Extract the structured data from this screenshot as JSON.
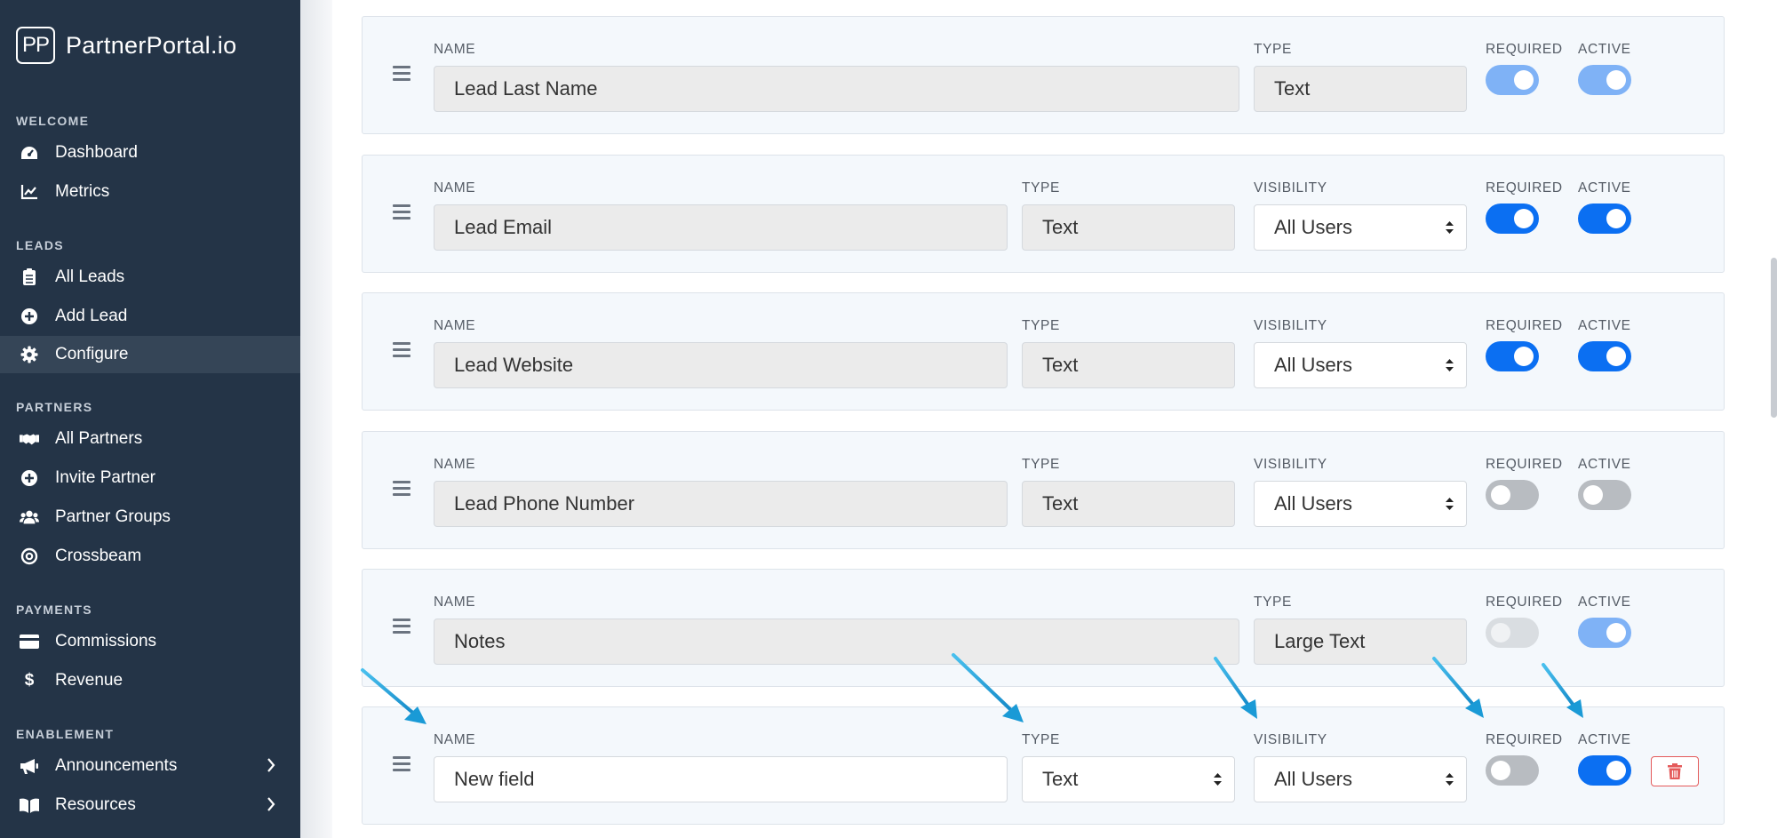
{
  "brand": {
    "logo": "PP",
    "name": "PartnerPortal.io"
  },
  "sidebar": {
    "sections": [
      {
        "label": "WELCOME",
        "items": [
          {
            "label": "Dashboard",
            "icon": "dashboard-icon"
          },
          {
            "label": "Metrics",
            "icon": "chart-line-icon"
          }
        ]
      },
      {
        "label": "LEADS",
        "items": [
          {
            "label": "All Leads",
            "icon": "clipboard-list-icon"
          },
          {
            "label": "Add Lead",
            "icon": "plus-circle-icon"
          },
          {
            "label": "Configure",
            "icon": "gear-icon",
            "active": true
          }
        ]
      },
      {
        "label": "PARTNERS",
        "items": [
          {
            "label": "All Partners",
            "icon": "handshake-icon"
          },
          {
            "label": "Invite Partner",
            "icon": "plus-circle-icon"
          },
          {
            "label": "Partner Groups",
            "icon": "users-icon"
          },
          {
            "label": "Crossbeam",
            "icon": "crossbeam-icon"
          }
        ]
      },
      {
        "label": "PAYMENTS",
        "items": [
          {
            "label": "Commissions",
            "icon": "credit-card-icon"
          },
          {
            "label": "Revenue",
            "icon": "dollar-icon"
          }
        ]
      },
      {
        "label": "ENABLEMENT",
        "items": [
          {
            "label": "Announcements",
            "icon": "megaphone-icon",
            "chevron": true
          },
          {
            "label": "Resources",
            "icon": "book-icon",
            "chevron": true
          }
        ]
      }
    ]
  },
  "labels": {
    "name": "NAME",
    "type": "TYPE",
    "visibility": "VISIBILITY",
    "required": "REQUIRED",
    "active": "ACTIVE"
  },
  "fields": [
    {
      "name": "Lead Last Name",
      "type": "Text",
      "required": true,
      "active": true,
      "muted": true
    },
    {
      "name": "Lead Email",
      "type": "Text",
      "visibility": "All Users",
      "required": true,
      "active": true
    },
    {
      "name": "Lead Website",
      "type": "Text",
      "visibility": "All Users",
      "required": true,
      "active": true
    },
    {
      "name": "Lead Phone Number",
      "type": "Text",
      "visibility": "All Users",
      "required": false,
      "active": false
    },
    {
      "name": "Notes",
      "type": "Large Text",
      "required": false,
      "active": true,
      "muted": true
    },
    {
      "name": "New field",
      "type": "Text",
      "visibility": "All Users",
      "required": false,
      "active": true,
      "editable": true
    }
  ],
  "colors": {
    "sidebar": "#243447",
    "toggle_on": "#0b6ff2",
    "arrow": "#1a9ad6",
    "delete": "#e45a5a"
  }
}
